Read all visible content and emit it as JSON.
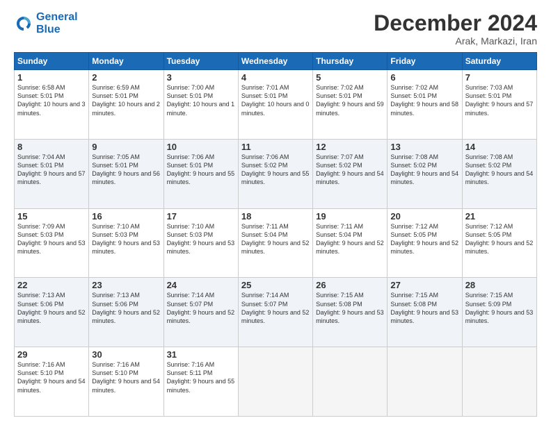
{
  "logo": {
    "line1": "General",
    "line2": "Blue"
  },
  "title": "December 2024",
  "location": "Arak, Markazi, Iran",
  "weekdays": [
    "Sunday",
    "Monday",
    "Tuesday",
    "Wednesday",
    "Thursday",
    "Friday",
    "Saturday"
  ],
  "weeks": [
    [
      {
        "day": "1",
        "sunrise": "6:58 AM",
        "sunset": "5:01 PM",
        "daylight": "10 hours and 3 minutes."
      },
      {
        "day": "2",
        "sunrise": "6:59 AM",
        "sunset": "5:01 PM",
        "daylight": "10 hours and 2 minutes."
      },
      {
        "day": "3",
        "sunrise": "7:00 AM",
        "sunset": "5:01 PM",
        "daylight": "10 hours and 1 minute."
      },
      {
        "day": "4",
        "sunrise": "7:01 AM",
        "sunset": "5:01 PM",
        "daylight": "10 hours and 0 minutes."
      },
      {
        "day": "5",
        "sunrise": "7:02 AM",
        "sunset": "5:01 PM",
        "daylight": "9 hours and 59 minutes."
      },
      {
        "day": "6",
        "sunrise": "7:02 AM",
        "sunset": "5:01 PM",
        "daylight": "9 hours and 58 minutes."
      },
      {
        "day": "7",
        "sunrise": "7:03 AM",
        "sunset": "5:01 PM",
        "daylight": "9 hours and 57 minutes."
      }
    ],
    [
      {
        "day": "8",
        "sunrise": "7:04 AM",
        "sunset": "5:01 PM",
        "daylight": "9 hours and 57 minutes."
      },
      {
        "day": "9",
        "sunrise": "7:05 AM",
        "sunset": "5:01 PM",
        "daylight": "9 hours and 56 minutes."
      },
      {
        "day": "10",
        "sunrise": "7:06 AM",
        "sunset": "5:01 PM",
        "daylight": "9 hours and 55 minutes."
      },
      {
        "day": "11",
        "sunrise": "7:06 AM",
        "sunset": "5:02 PM",
        "daylight": "9 hours and 55 minutes."
      },
      {
        "day": "12",
        "sunrise": "7:07 AM",
        "sunset": "5:02 PM",
        "daylight": "9 hours and 54 minutes."
      },
      {
        "day": "13",
        "sunrise": "7:08 AM",
        "sunset": "5:02 PM",
        "daylight": "9 hours and 54 minutes."
      },
      {
        "day": "14",
        "sunrise": "7:08 AM",
        "sunset": "5:02 PM",
        "daylight": "9 hours and 54 minutes."
      }
    ],
    [
      {
        "day": "15",
        "sunrise": "7:09 AM",
        "sunset": "5:03 PM",
        "daylight": "9 hours and 53 minutes."
      },
      {
        "day": "16",
        "sunrise": "7:10 AM",
        "sunset": "5:03 PM",
        "daylight": "9 hours and 53 minutes."
      },
      {
        "day": "17",
        "sunrise": "7:10 AM",
        "sunset": "5:03 PM",
        "daylight": "9 hours and 53 minutes."
      },
      {
        "day": "18",
        "sunrise": "7:11 AM",
        "sunset": "5:04 PM",
        "daylight": "9 hours and 52 minutes."
      },
      {
        "day": "19",
        "sunrise": "7:11 AM",
        "sunset": "5:04 PM",
        "daylight": "9 hours and 52 minutes."
      },
      {
        "day": "20",
        "sunrise": "7:12 AM",
        "sunset": "5:05 PM",
        "daylight": "9 hours and 52 minutes."
      },
      {
        "day": "21",
        "sunrise": "7:12 AM",
        "sunset": "5:05 PM",
        "daylight": "9 hours and 52 minutes."
      }
    ],
    [
      {
        "day": "22",
        "sunrise": "7:13 AM",
        "sunset": "5:06 PM",
        "daylight": "9 hours and 52 minutes."
      },
      {
        "day": "23",
        "sunrise": "7:13 AM",
        "sunset": "5:06 PM",
        "daylight": "9 hours and 52 minutes."
      },
      {
        "day": "24",
        "sunrise": "7:14 AM",
        "sunset": "5:07 PM",
        "daylight": "9 hours and 52 minutes."
      },
      {
        "day": "25",
        "sunrise": "7:14 AM",
        "sunset": "5:07 PM",
        "daylight": "9 hours and 52 minutes."
      },
      {
        "day": "26",
        "sunrise": "7:15 AM",
        "sunset": "5:08 PM",
        "daylight": "9 hours and 53 minutes."
      },
      {
        "day": "27",
        "sunrise": "7:15 AM",
        "sunset": "5:08 PM",
        "daylight": "9 hours and 53 minutes."
      },
      {
        "day": "28",
        "sunrise": "7:15 AM",
        "sunset": "5:09 PM",
        "daylight": "9 hours and 53 minutes."
      }
    ],
    [
      {
        "day": "29",
        "sunrise": "7:16 AM",
        "sunset": "5:10 PM",
        "daylight": "9 hours and 54 minutes."
      },
      {
        "day": "30",
        "sunrise": "7:16 AM",
        "sunset": "5:10 PM",
        "daylight": "9 hours and 54 minutes."
      },
      {
        "day": "31",
        "sunrise": "7:16 AM",
        "sunset": "5:11 PM",
        "daylight": "9 hours and 55 minutes."
      },
      null,
      null,
      null,
      null
    ]
  ]
}
